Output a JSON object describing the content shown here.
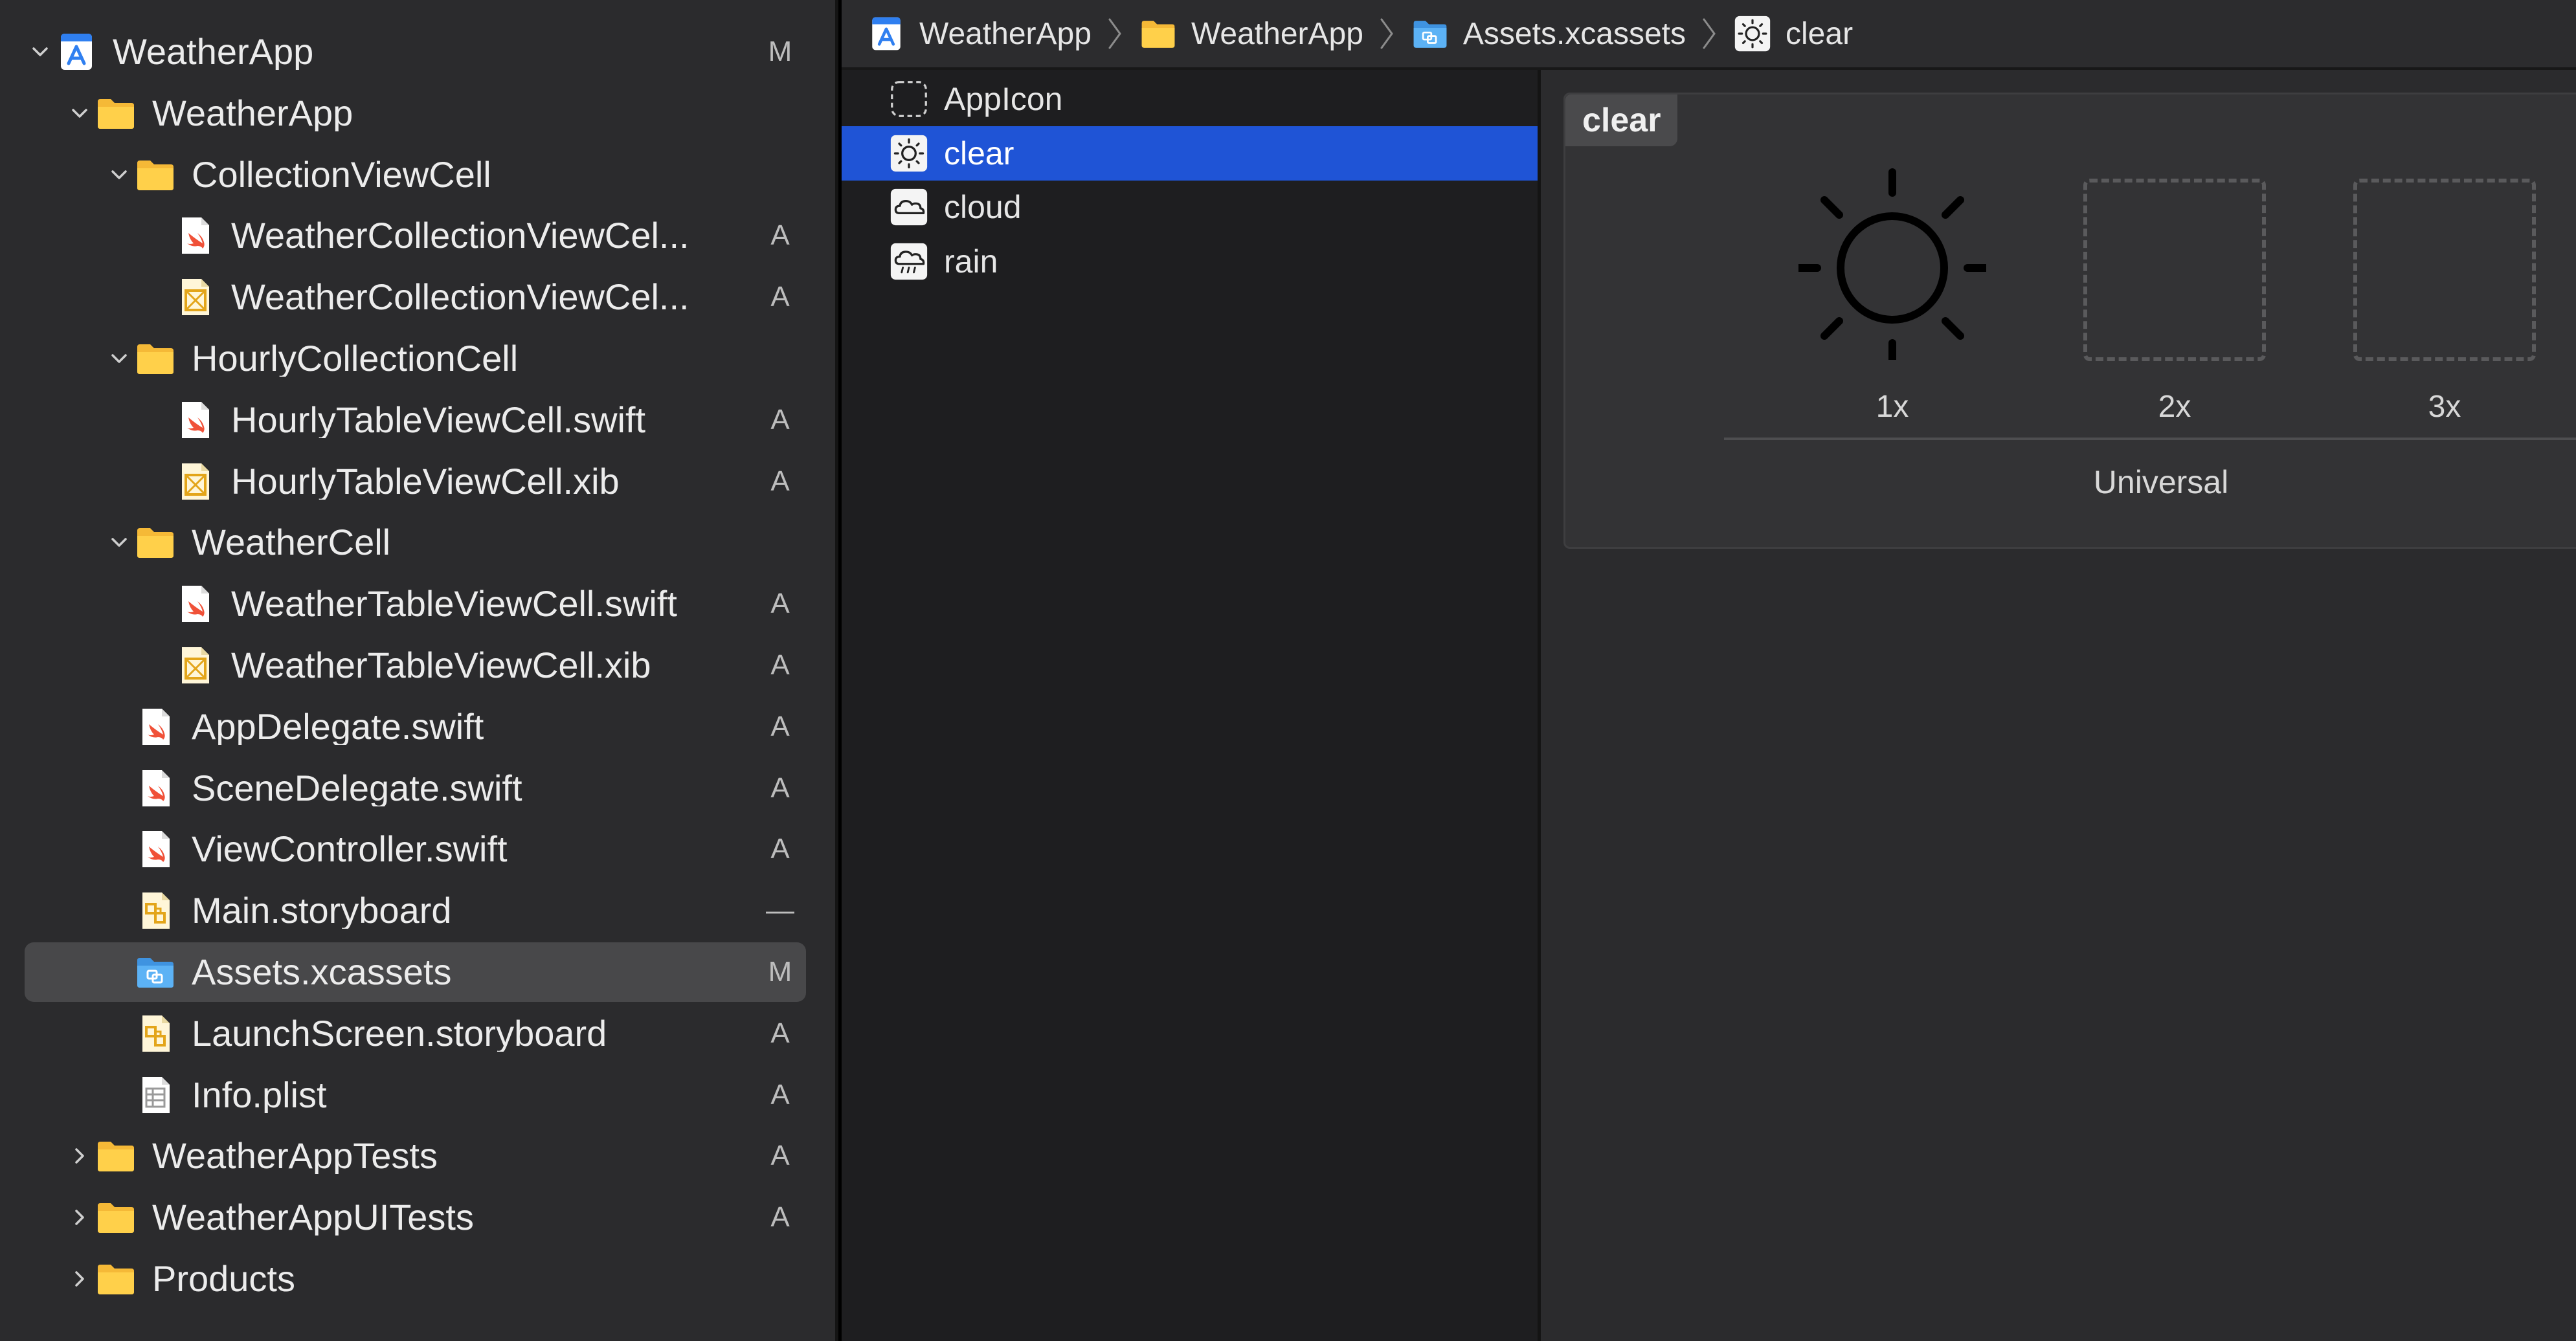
{
  "navigator": {
    "items": [
      {
        "label": "WeatherApp",
        "status": "M",
        "indent": 0,
        "icon": "xcode-project-icon",
        "disclosure": "open"
      },
      {
        "label": "WeatherApp",
        "status": "",
        "indent": 1,
        "icon": "folder-icon",
        "disclosure": "open"
      },
      {
        "label": "CollectionViewCell",
        "status": "",
        "indent": 2,
        "icon": "folder-icon",
        "disclosure": "open"
      },
      {
        "label": "WeatherCollectionViewCel...",
        "status": "A",
        "indent": 3,
        "icon": "swift-file-icon",
        "disclosure": "none"
      },
      {
        "label": "WeatherCollectionViewCel...",
        "status": "A",
        "indent": 3,
        "icon": "xib-file-icon",
        "disclosure": "none"
      },
      {
        "label": "HourlyCollectionCell",
        "status": "",
        "indent": 2,
        "icon": "folder-icon",
        "disclosure": "open"
      },
      {
        "label": "HourlyTableViewCell.swift",
        "status": "A",
        "indent": 3,
        "icon": "swift-file-icon",
        "disclosure": "none"
      },
      {
        "label": "HourlyTableViewCell.xib",
        "status": "A",
        "indent": 3,
        "icon": "xib-file-icon",
        "disclosure": "none"
      },
      {
        "label": "WeatherCell",
        "status": "",
        "indent": 2,
        "icon": "folder-icon",
        "disclosure": "open"
      },
      {
        "label": "WeatherTableViewCell.swift",
        "status": "A",
        "indent": 3,
        "icon": "swift-file-icon",
        "disclosure": "none"
      },
      {
        "label": "WeatherTableViewCell.xib",
        "status": "A",
        "indent": 3,
        "icon": "xib-file-icon",
        "disclosure": "none"
      },
      {
        "label": "AppDelegate.swift",
        "status": "A",
        "indent": 2,
        "icon": "swift-file-icon",
        "disclosure": "none"
      },
      {
        "label": "SceneDelegate.swift",
        "status": "A",
        "indent": 2,
        "icon": "swift-file-icon",
        "disclosure": "none"
      },
      {
        "label": "ViewController.swift",
        "status": "A",
        "indent": 2,
        "icon": "swift-file-icon",
        "disclosure": "none"
      },
      {
        "label": "Main.storyboard",
        "status": "—",
        "indent": 2,
        "icon": "storyboard-file-icon",
        "disclosure": "none"
      },
      {
        "label": "Assets.xcassets",
        "status": "M",
        "indent": 2,
        "icon": "asset-catalog-icon",
        "disclosure": "none",
        "selected": true
      },
      {
        "label": "LaunchScreen.storyboard",
        "status": "A",
        "indent": 2,
        "icon": "storyboard-file-icon",
        "disclosure": "none"
      },
      {
        "label": "Info.plist",
        "status": "A",
        "indent": 2,
        "icon": "plist-file-icon",
        "disclosure": "none"
      },
      {
        "label": "WeatherAppTests",
        "status": "A",
        "indent": 1,
        "icon": "folder-icon",
        "disclosure": "closed"
      },
      {
        "label": "WeatherAppUITests",
        "status": "A",
        "indent": 1,
        "icon": "folder-icon",
        "disclosure": "closed"
      },
      {
        "label": "Products",
        "status": "",
        "indent": 1,
        "icon": "folder-icon",
        "disclosure": "closed"
      }
    ]
  },
  "jumpbar": {
    "crumbs": [
      {
        "label": "WeatherApp",
        "icon": "xcode-project-icon"
      },
      {
        "label": "WeatherApp",
        "icon": "folder-icon"
      },
      {
        "label": "Assets.xcassets",
        "icon": "asset-catalog-icon"
      },
      {
        "label": "clear",
        "icon": "sun-image-set-icon"
      }
    ]
  },
  "asset_list": {
    "items": [
      {
        "label": "AppIcon",
        "icon": "app-icon-placeholder-icon"
      },
      {
        "label": "clear",
        "icon": "sun-image-set-icon",
        "selected": true
      },
      {
        "label": "cloud",
        "icon": "cloud-image-set-icon"
      },
      {
        "label": "rain",
        "icon": "rain-image-set-icon"
      }
    ]
  },
  "editor": {
    "asset_name": "clear",
    "slots": [
      {
        "label": "1x",
        "filled": true,
        "icon": "sun-icon"
      },
      {
        "label": "2x",
        "filled": false
      },
      {
        "label": "3x",
        "filled": false
      }
    ],
    "group_label": "Universal"
  },
  "colors": {
    "selection_blue": "#1f54d6",
    "folder_yellow": "#f7c23a",
    "swift_red": "#f05138",
    "asset_blue": "#4aa8f0"
  }
}
